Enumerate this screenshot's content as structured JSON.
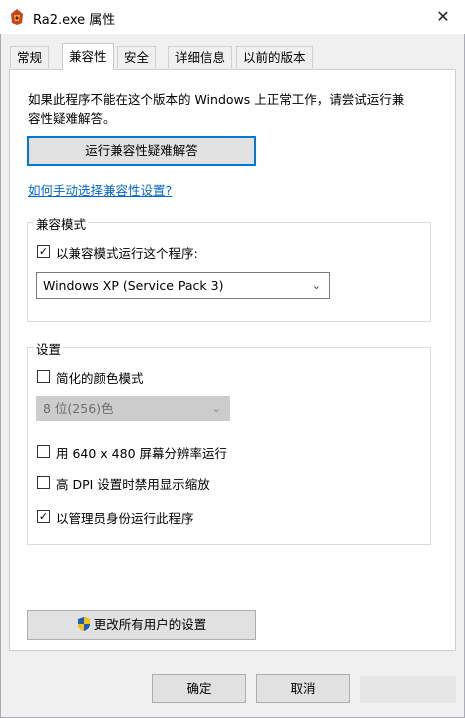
{
  "window": {
    "title": "Ra2.exe 属性",
    "close_glyph": "✕"
  },
  "tabs": [
    {
      "label": "常规"
    },
    {
      "label": "兼容性"
    },
    {
      "label": "安全"
    },
    {
      "label": "详细信息"
    },
    {
      "label": "以前的版本"
    }
  ],
  "compat": {
    "intro_line1": "如果此程序不能在这个版本的 Windows 上正常工作，请尝试运行兼",
    "intro_line2": "容性疑难解答。",
    "troubleshoot_button": "运行兼容性疑难解答",
    "manual_link": "如何手动选择兼容性设置?"
  },
  "compat_mode": {
    "legend": "兼容模式",
    "checkbox_label": "以兼容模式运行这个程序:",
    "checked": true,
    "selected_os": "Windows XP (Service Pack 3)"
  },
  "settings": {
    "legend": "设置",
    "reduced_color": {
      "label": "简化的颜色模式",
      "checked": false
    },
    "color_select": "8 位(256)色",
    "res_640": {
      "label": "用 640 x 480 屏幕分辨率运行",
      "checked": false
    },
    "high_dpi": {
      "label": "高 DPI 设置时禁用显示缩放",
      "checked": false
    },
    "run_admin": {
      "label": "以管理员身份运行此程序",
      "checked": true
    }
  },
  "all_users_button": "更改所有用户的设置",
  "footer": {
    "ok": "确定",
    "cancel": "取消"
  },
  "colors": {
    "accent": "#0078d7",
    "link": "#0066cc",
    "background": "#f0f0f0"
  }
}
